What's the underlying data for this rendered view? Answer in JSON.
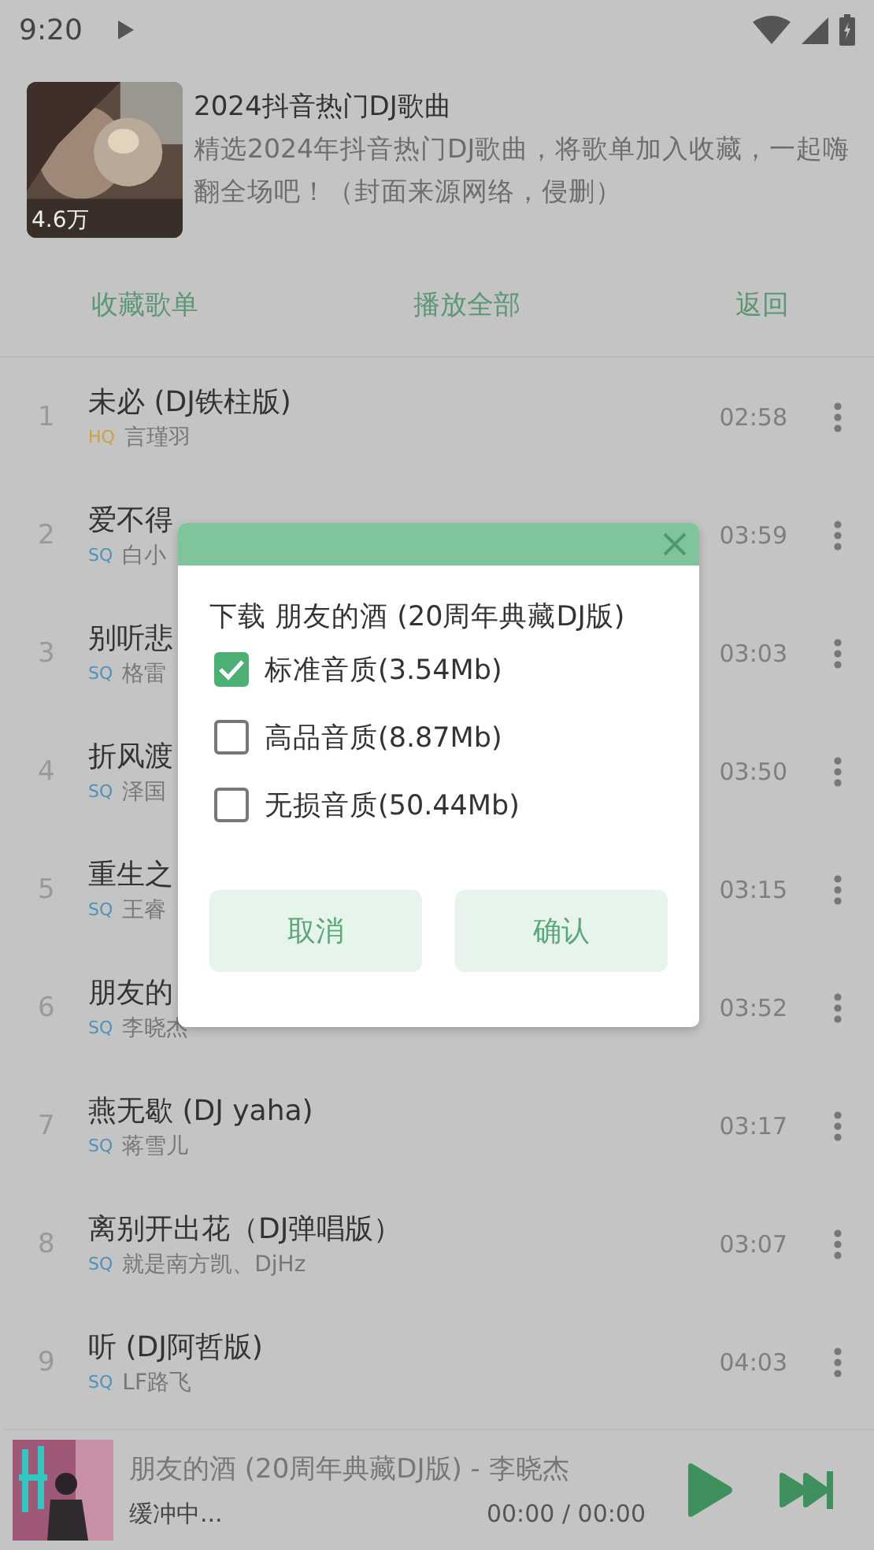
{
  "status_bar": {
    "time": "9:20"
  },
  "playlist": {
    "title": "2024抖音热门DJ歌曲",
    "description": "精选2024年抖音热门DJ歌曲，将歌单加入收藏，一起嗨翻全场吧！（封面来源网络，侵删）",
    "play_count": "4.6万"
  },
  "actions": [
    "收藏歌单",
    "播放全部",
    "返回"
  ],
  "songs": [
    {
      "index": "1",
      "title": "未必 (DJ铁柱版)",
      "quality": "HQ",
      "color": "#c9a24a",
      "artist": "言瑾羽",
      "duration": "02:58"
    },
    {
      "index": "2",
      "title": "爱不得",
      "quality": "SQ",
      "color": "#4f93bb",
      "artist": "白小",
      "duration": "03:59"
    },
    {
      "index": "3",
      "title": "别听悲",
      "quality": "SQ",
      "color": "#4f93bb",
      "artist": "格雷",
      "duration": "03:03"
    },
    {
      "index": "4",
      "title": "折风渡",
      "quality": "SQ",
      "color": "#4f93bb",
      "artist": "泽国",
      "duration": "03:50"
    },
    {
      "index": "5",
      "title": "重生之",
      "quality": "SQ",
      "color": "#4f93bb",
      "artist": "王睿",
      "duration": "03:15"
    },
    {
      "index": "6",
      "title": "朋友的",
      "quality": "SQ",
      "color": "#4f93bb",
      "artist": "李晓杰",
      "duration": "03:52"
    },
    {
      "index": "7",
      "title": "燕无歇 (DJ yaha)",
      "quality": "SQ",
      "color": "#4f93bb",
      "artist": "蒋雪儿",
      "duration": "03:17"
    },
    {
      "index": "8",
      "title": "离别开出花（DJ弹唱版）",
      "quality": "SQ",
      "color": "#4f93bb",
      "artist": "就是南方凯、DjHz",
      "duration": "03:07"
    },
    {
      "index": "9",
      "title": "听 (DJ阿哲版)",
      "quality": "SQ",
      "color": "#4f93bb",
      "artist": "LF路飞",
      "duration": "04:03"
    }
  ],
  "dialog": {
    "title": "下载 朋友的酒 (20周年典藏DJ版)",
    "options": [
      {
        "label": "标准音质(3.54Mb)",
        "checked": true
      },
      {
        "label": "高品音质(8.87Mb)",
        "checked": false
      },
      {
        "label": "无损音质(50.44Mb)",
        "checked": false
      }
    ],
    "buttons": [
      "取消",
      "确认"
    ]
  },
  "player": {
    "title": "朋友的酒 (20周年典藏DJ版) - 李晓杰",
    "status": "缓冲中...",
    "time": "00:00 / 00:00"
  }
}
